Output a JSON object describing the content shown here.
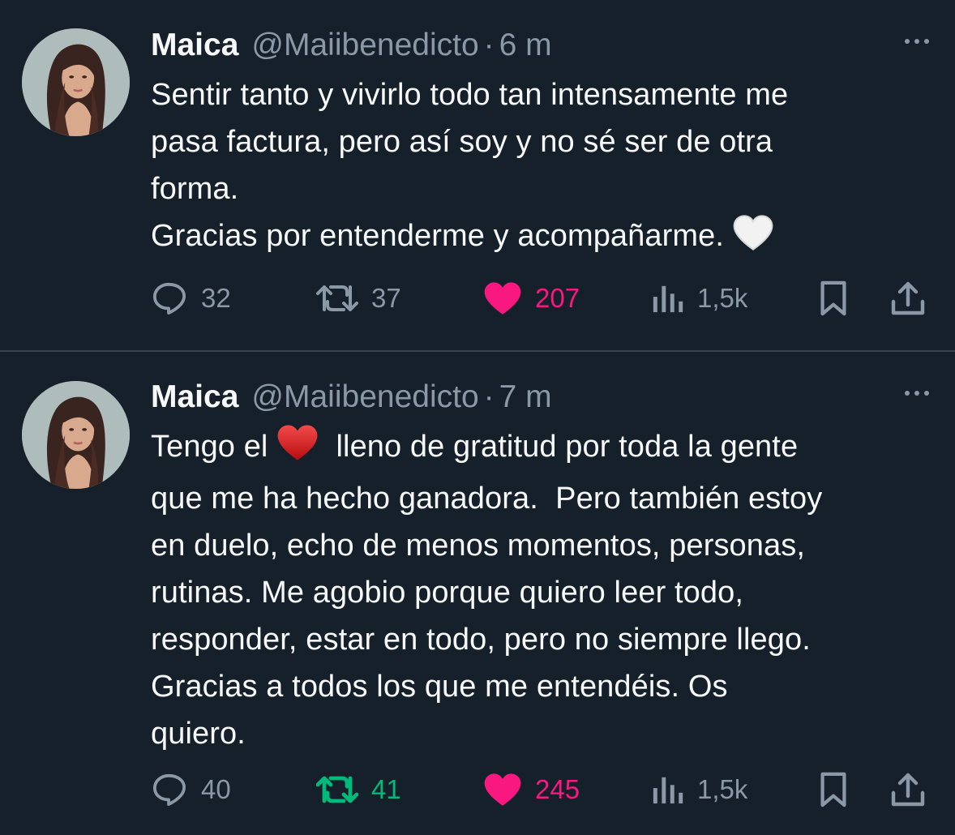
{
  "tweets": [
    {
      "name": "Maica",
      "handle": "@Maiibenedicto",
      "separator": "·",
      "time": "6 m",
      "lines": [
        "Sentir tanto y vivirlo todo tan intensamente me",
        "pasa factura, pero así soy y no sé ser de otra",
        "forma.",
        "Gracias por entenderme y acompañarme."
      ],
      "emoji": "white-heart",
      "replies": "32",
      "retweets": "37",
      "likes": "207",
      "views": "1,5k",
      "retweeted": false,
      "liked": true
    },
    {
      "name": "Maica",
      "handle": "@Maiibenedicto",
      "separator": "·",
      "time": "7 m",
      "line1_before": "Tengo el",
      "emoji": "red-heart",
      "line1_after": "lleno de gratitud por toda la gente",
      "lines": [
        "que me ha hecho ganadora.  Pero también estoy",
        "en duelo, echo de menos momentos, personas,",
        "rutinas. Me agobio porque quiero leer todo,",
        "responder, estar en todo, pero no siempre llego.",
        "Gracias a todos los que me entendéis. Os",
        "quiero."
      ],
      "replies": "40",
      "retweets": "41",
      "likes": "245",
      "views": "1,5k",
      "retweeted": true,
      "liked": true
    }
  ],
  "colors": {
    "background": "#15202b",
    "text": "#f7f9f9",
    "muted": "#8b98a5",
    "like": "#f91880",
    "retweet": "#00ba7c",
    "divider": "#38444d"
  }
}
